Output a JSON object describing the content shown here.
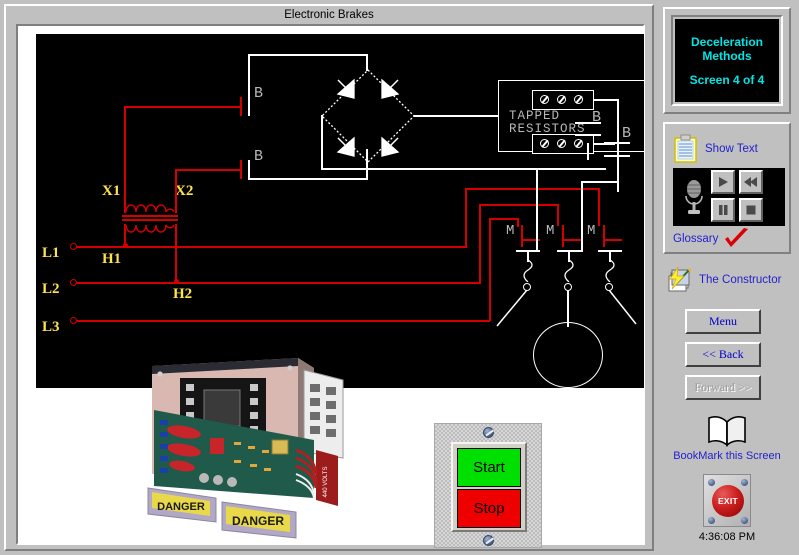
{
  "window": {
    "title": "Electronic Brakes"
  },
  "title_panel": {
    "line1": "Deceleration",
    "line2": "Methods",
    "screen_count": "Screen 4 of 4",
    "text_color": "#00e5e5",
    "background": "#000000"
  },
  "media_panel": {
    "show_text_label": "Show Text",
    "show_text_icon": "clipboard-icon",
    "microphone_icon": "microphone-icon",
    "buttons": [
      {
        "name": "play-button",
        "glyph": "▶"
      },
      {
        "name": "rewind-button",
        "glyph": "◀◀"
      },
      {
        "name": "pause-button",
        "glyph": "❙❙"
      },
      {
        "name": "stop-button",
        "glyph": "■"
      }
    ],
    "glossary_label": "Glossary",
    "glossary_icon": "red-checkmark-icon"
  },
  "constructor": {
    "label": "The Constructor",
    "icon": "lightning-bolt-document-icon"
  },
  "navigation": {
    "menu_label": "Menu",
    "back_label": "<< Back",
    "forward_label": "Forward >>",
    "forward_disabled": true
  },
  "bookmark": {
    "label": "BookMark this Screen",
    "icon": "open-book-icon"
  },
  "exit": {
    "label": "EXIT",
    "button_color": "#cc1f1f"
  },
  "clock": {
    "time": "4:36:08 PM"
  },
  "control_station": {
    "start_label": "Start",
    "stop_label": "Stop",
    "start_color": "#00e000",
    "stop_color": "#ee0000"
  },
  "schematic": {
    "background": "#000000",
    "line_colors": {
      "power": "#d40000",
      "control": "#ffffff",
      "terminal_label": "#ffe34d",
      "device_label": "#b8b8b8"
    },
    "line_terminals": [
      "L1",
      "L2",
      "L3"
    ],
    "transformer": {
      "primary_labels": [
        "H1",
        "H2"
      ],
      "secondary_labels": [
        "X1",
        "X2"
      ]
    },
    "contacts_b": [
      "B",
      "B",
      "B",
      "B"
    ],
    "contacts_m": [
      "M",
      "M",
      "M"
    ],
    "resistor_box_label": "TAPPED RESISTORS",
    "rectifier": "diode-bridge-rectifier",
    "motor": "three-phase-motor"
  },
  "photo": {
    "caption_labels": [
      "DANGER",
      "DANGER",
      "440 VOLTS"
    ],
    "description": "electronic-brake-control-unit"
  }
}
